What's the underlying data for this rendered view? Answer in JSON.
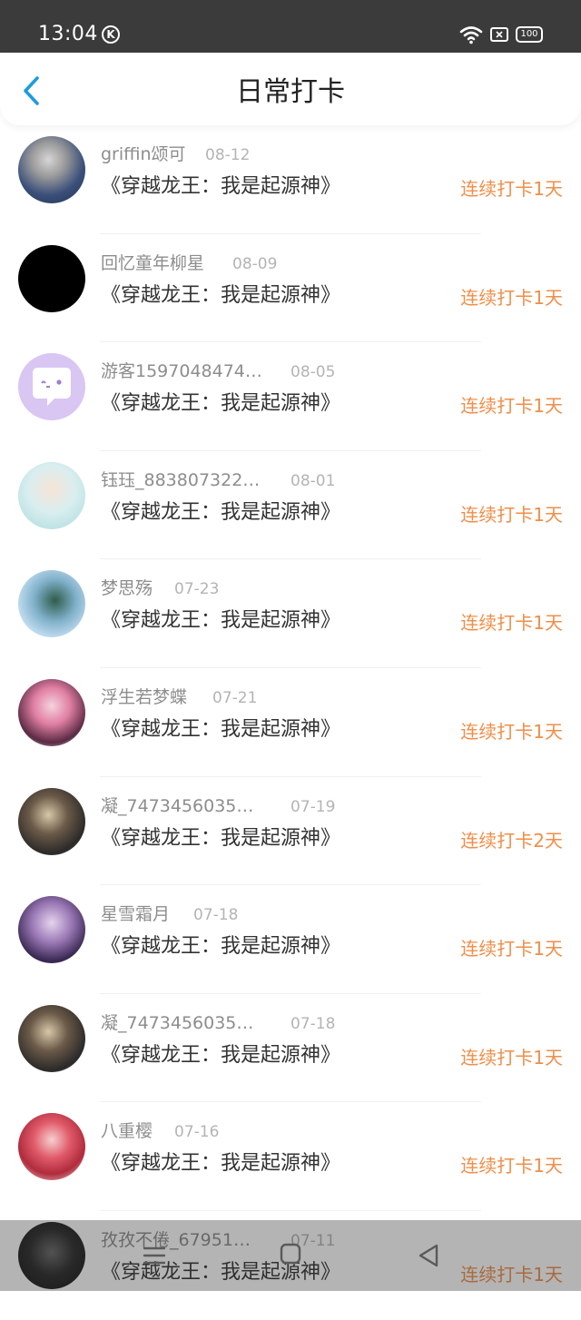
{
  "status_bar": {
    "time": "13:04",
    "k_label": "K",
    "battery": "100"
  },
  "header": {
    "title": "日常打卡"
  },
  "entries": [
    {
      "username": "griffin颂可",
      "date": "08-12",
      "book": "《穿越龙王：我是起源神》",
      "streak": "连续打卡1天"
    },
    {
      "username": "回忆童年柳星",
      "date": "08-09",
      "book": "《穿越龙王：我是起源神》",
      "streak": "连续打卡1天"
    },
    {
      "username": "游客1597048474…",
      "date": "08-05",
      "book": "《穿越龙王：我是起源神》",
      "streak": "连续打卡1天"
    },
    {
      "username": "钰珏_883807322…",
      "date": "08-01",
      "book": "《穿越龙王：我是起源神》",
      "streak": "连续打卡1天"
    },
    {
      "username": "梦思殇",
      "date": "07-23",
      "book": "《穿越龙王：我是起源神》",
      "streak": "连续打卡1天"
    },
    {
      "username": "浮生若梦蝶",
      "date": "07-21",
      "book": "《穿越龙王：我是起源神》",
      "streak": "连续打卡1天"
    },
    {
      "username": "凝_7473456035…",
      "date": "07-19",
      "book": "《穿越龙王：我是起源神》",
      "streak": "连续打卡2天"
    },
    {
      "username": "星雪霜月",
      "date": "07-18",
      "book": "《穿越龙王：我是起源神》",
      "streak": "连续打卡1天"
    },
    {
      "username": "凝_7473456035…",
      "date": "07-18",
      "book": "《穿越龙王：我是起源神》",
      "streak": "连续打卡1天"
    },
    {
      "username": "八重樱",
      "date": "07-16",
      "book": "《穿越龙王：我是起源神》",
      "streak": "连续打卡1天"
    },
    {
      "username": "孜孜不倦_67951…",
      "date": "07-11",
      "book": "《穿越龙王：我是起源神》",
      "streak": "连续打卡1天"
    }
  ],
  "icons": {
    "back": "chevron-left-icon",
    "wifi": "wifi-icon",
    "sim": "sim-icon",
    "battery": "battery-icon",
    "nav_menu": "menu-icon",
    "nav_home": "home-icon",
    "nav_back": "back-triangle-icon"
  },
  "colors": {
    "accent_blue": "#1e9be0",
    "streak_orange": "#f08e48",
    "status_bar": "#3b3b3b"
  }
}
